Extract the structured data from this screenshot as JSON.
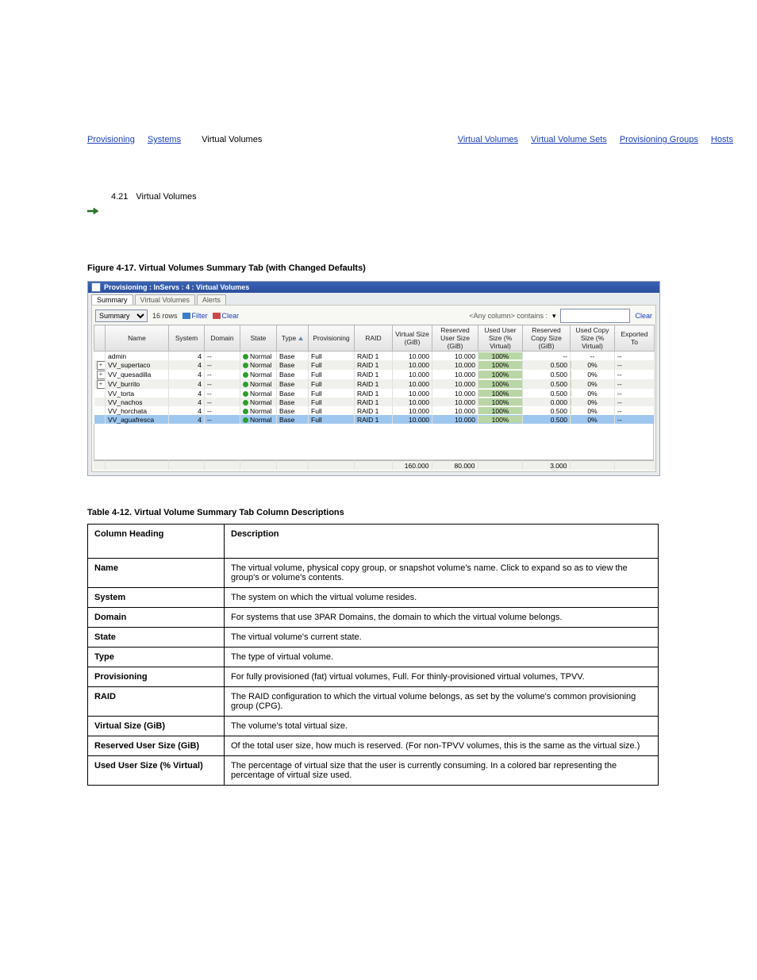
{
  "header": {
    "breadcrumbs_left": [
      "Provisioning",
      "Systems"
    ],
    "breadcrumbs_right": [
      "Virtual Volumes",
      "Virtual Volume Sets",
      "Provisioning Groups",
      "Hosts"
    ],
    "chapter_label": "Virtual Volumes",
    "chapter_count": "4.21"
  },
  "figure_heading": "Figure 4-17.  Virtual Volumes Summary Tab (with Changed Defaults)",
  "panel": {
    "title": "Provisioning : InServs : 4 : Virtual Volumes",
    "tabs": [
      "Summary",
      "Virtual Volumes",
      "Alerts"
    ],
    "active_tab": 0,
    "view_select": "Summary",
    "rows_label": "16 rows",
    "filter_label": "Filter",
    "clear_label": "Clear",
    "anycol_label": "<Any column> contains :",
    "clear_right": "Clear",
    "columns": [
      "",
      "Name",
      "System",
      "Domain",
      "State",
      "Type",
      "Provisioning",
      "RAID",
      "Virtual Size (GiB)",
      "Reserved User Size (GiB)",
      "Used User Size (% Virtual)",
      "Reserved Copy Size (GiB)",
      "Used Copy Size (% Virtual)",
      "Exported To"
    ],
    "rows": [
      {
        "exp": "",
        "name": "admin",
        "system": "4",
        "domain": "--",
        "state": "Normal",
        "type": "Base",
        "prov": "Full",
        "raid": "RAID 1",
        "vsize": "10.000",
        "ruser": "10.000",
        "uuser": "100%",
        "rcopy": "--",
        "ucopy": "--",
        "exp_to": "--"
      },
      {
        "exp": "+",
        "name": "VV_supertaco",
        "system": "4",
        "domain": "--",
        "state": "Normal",
        "type": "Base",
        "prov": "Full",
        "raid": "RAID 1",
        "vsize": "10.000",
        "ruser": "10.000",
        "uuser": "100%",
        "rcopy": "0.500",
        "ucopy": "0%",
        "exp_to": "--"
      },
      {
        "exp": "+",
        "name": "VV_quesadilla",
        "system": "4",
        "domain": "--",
        "state": "Normal",
        "type": "Base",
        "prov": "Full",
        "raid": "RAID 1",
        "vsize": "10.000",
        "ruser": "10.000",
        "uuser": "100%",
        "rcopy": "0.500",
        "ucopy": "0%",
        "exp_to": "--"
      },
      {
        "exp": "+",
        "name": "VV_burrito",
        "system": "4",
        "domain": "--",
        "state": "Normal",
        "type": "Base",
        "prov": "Full",
        "raid": "RAID 1",
        "vsize": "10.000",
        "ruser": "10.000",
        "uuser": "100%",
        "rcopy": "0.500",
        "ucopy": "0%",
        "exp_to": "--"
      },
      {
        "exp": "",
        "name": "VV_torta",
        "system": "4",
        "domain": "--",
        "state": "Normal",
        "type": "Base",
        "prov": "Full",
        "raid": "RAID 1",
        "vsize": "10.000",
        "ruser": "10.000",
        "uuser": "100%",
        "rcopy": "0.500",
        "ucopy": "0%",
        "exp_to": "--"
      },
      {
        "exp": "",
        "name": "VV_nachos",
        "system": "4",
        "domain": "--",
        "state": "Normal",
        "type": "Base",
        "prov": "Full",
        "raid": "RAID 1",
        "vsize": "10.000",
        "ruser": "10.000",
        "uuser": "100%",
        "rcopy": "0.000",
        "ucopy": "0%",
        "exp_to": "--"
      },
      {
        "exp": "",
        "name": "VV_horchata",
        "system": "4",
        "domain": "--",
        "state": "Normal",
        "type": "Base",
        "prov": "Full",
        "raid": "RAID 1",
        "vsize": "10.000",
        "ruser": "10.000",
        "uuser": "100%",
        "rcopy": "0.500",
        "ucopy": "0%",
        "exp_to": "--"
      },
      {
        "exp": "",
        "name": "VV_aguafresca",
        "system": "4",
        "domain": "--",
        "state": "Normal",
        "type": "Base",
        "prov": "Full",
        "raid": "RAID 1",
        "vsize": "10.000",
        "ruser": "10.000",
        "uuser": "100%",
        "rcopy": "0.500",
        "ucopy": "0%",
        "exp_to": "--",
        "selected": true
      }
    ],
    "totals": {
      "vsize": "160.000",
      "ruser": "80.000",
      "rcopy": "3.000"
    }
  },
  "table_heading": "Table 4-12.  Virtual Volume Summary Tab Column Descriptions",
  "desc_header": [
    "Column Heading",
    "Description"
  ],
  "desc_rows": [
    {
      "col": "Name",
      "desc": "The virtual volume, physical copy group, or snapshot volume's name. Click to expand so as to view the group's or volume's contents."
    },
    {
      "col": "System",
      "desc": "The system on which the virtual volume resides."
    },
    {
      "col": "Domain",
      "desc": "For systems that use 3PAR Domains, the domain to which the virtual volume belongs."
    },
    {
      "col": "State",
      "desc": "The virtual volume's current state."
    },
    {
      "col": "Type",
      "desc": "The type of virtual volume."
    },
    {
      "col": "Provisioning",
      "desc": "For fully provisioned (fat) virtual volumes, Full. For thinly-provisioned virtual volumes, TPVV."
    },
    {
      "col": "RAID",
      "desc": "The RAID configuration to which the virtual volume belongs, as set by the volume's common provisioning group (CPG)."
    },
    {
      "col": "Virtual Size (GiB)",
      "desc": "The volume's total virtual size."
    },
    {
      "col": "Reserved User Size (GiB)",
      "desc": "Of the total user size, how much is reserved. (For non-TPVV volumes, this is the same as the virtual size.)"
    },
    {
      "col": "Used User Size (% Virtual)",
      "desc": "The percentage of virtual size that the user is currently consuming. In a colored bar representing the percentage of virtual size used."
    }
  ]
}
